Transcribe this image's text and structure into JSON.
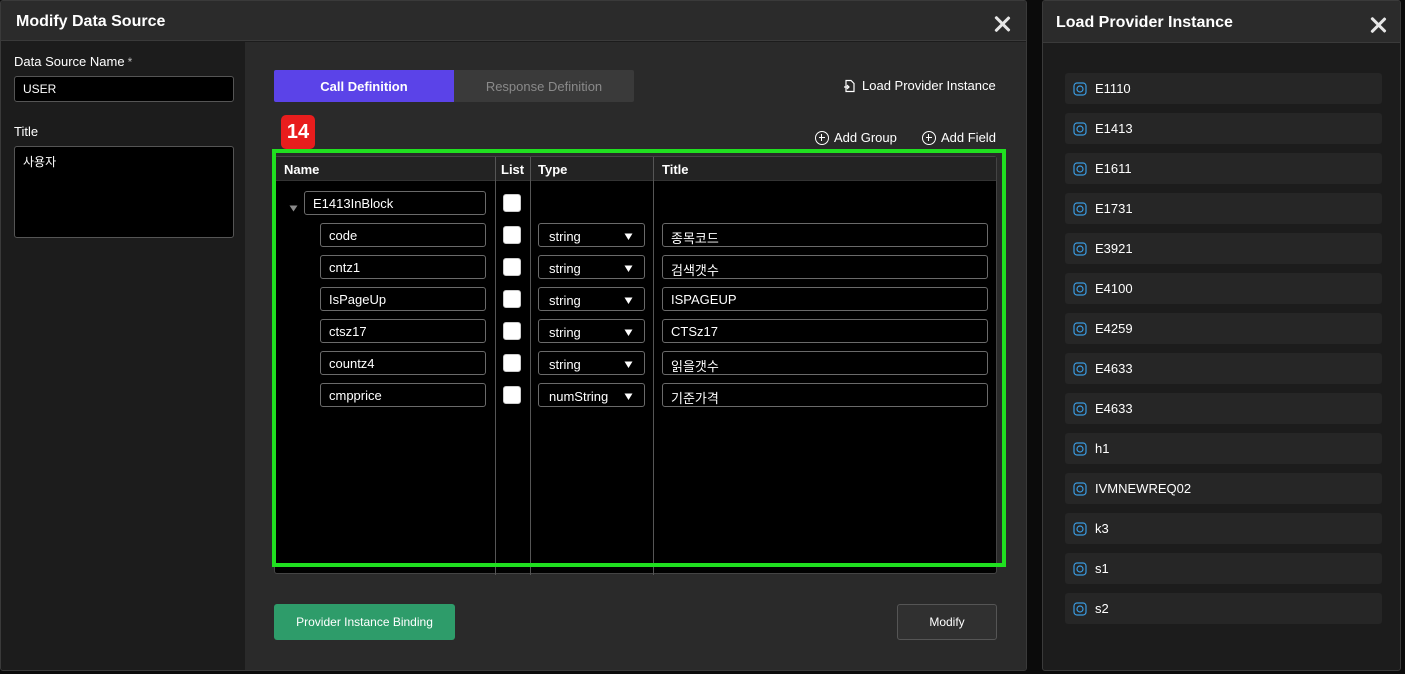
{
  "dialog": {
    "title": "Modify Data Source",
    "ds_name_label": "Data Source Name",
    "required_mark": "*",
    "ds_name_value": "USER",
    "title_label": "Title",
    "title_value": "사용자",
    "tabs": [
      {
        "label": "Call Definition",
        "active": true
      },
      {
        "label": "Response Definition",
        "active": false
      }
    ],
    "load_provider_link": "Load Provider Instance",
    "add_group": "Add Group",
    "add_field": "Add Field",
    "badge": "14",
    "columns": {
      "name": "Name",
      "list": "List",
      "type": "Type",
      "title": "Title"
    },
    "group_name": "E1413InBlock",
    "fields": [
      {
        "name": "code",
        "type": "string",
        "title": "종목코드"
      },
      {
        "name": "cntz1",
        "type": "string",
        "title": "검색갯수"
      },
      {
        "name": "IsPageUp",
        "type": "string",
        "title": "ISPAGEUP"
      },
      {
        "name": "ctsz17",
        "type": "string",
        "title": "CTSz17"
      },
      {
        "name": "countz4",
        "type": "string",
        "title": "읽을갯수"
      },
      {
        "name": "cmpprice",
        "type": "numString",
        "title": "기준가격"
      }
    ],
    "binding_button": "Provider Instance Binding",
    "modify_button": "Modify"
  },
  "panel": {
    "title": "Load Provider Instance",
    "items": [
      "E1110",
      "E1413",
      "E1611",
      "E1731",
      "E3921",
      "E4100",
      "E4259",
      "E4633",
      "E4633",
      "h1",
      "IVMNEWREQ02",
      "k3",
      "s1",
      "s2"
    ]
  },
  "colors": {
    "accent": "#5b43e8",
    "highlight": "#20e020",
    "badge": "#e81d1d",
    "binding_green": "#2e9c6a",
    "icon_blue": "#3a9be0"
  }
}
